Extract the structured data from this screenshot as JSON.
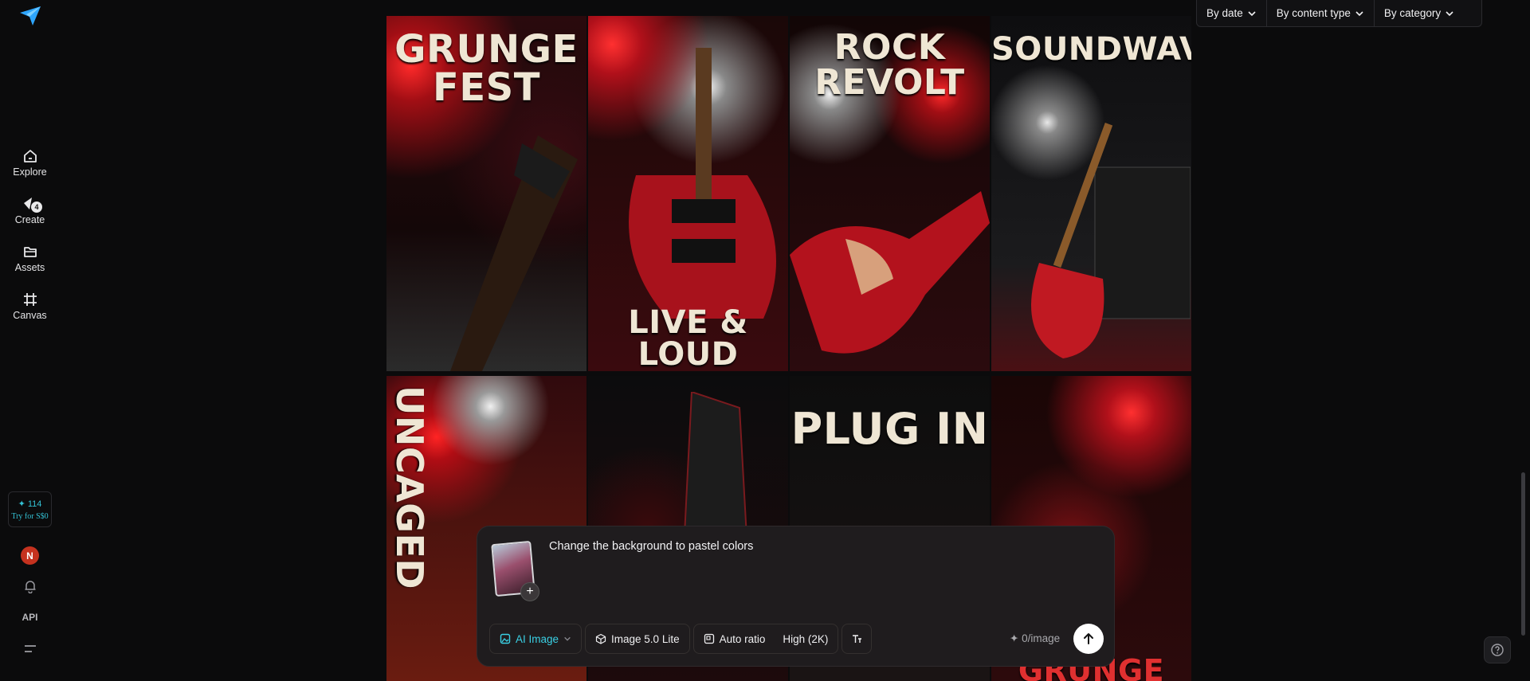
{
  "sidebar": {
    "nav": [
      {
        "label": "Explore"
      },
      {
        "label": "Create",
        "badge": "4"
      },
      {
        "label": "Assets"
      },
      {
        "label": "Canvas"
      }
    ],
    "credits": {
      "amount": "114",
      "offer": "Try for S$0"
    },
    "avatar_initial": "N",
    "api_label": "API"
  },
  "filters": [
    {
      "label": "By date"
    },
    {
      "label": "By content type"
    },
    {
      "label": "By category"
    }
  ],
  "gallery": {
    "tiles": [
      {
        "title": "GRUNGE\nFEST"
      },
      {
        "title": "LIVE & LOUD"
      },
      {
        "title": "ROCK REVOLT"
      },
      {
        "title": "SOUNDWAVE"
      },
      {
        "title": "UNCAGED"
      },
      {
        "title": ""
      },
      {
        "title": "PLUG IN"
      },
      {
        "title": "OF\nGRUNGE"
      }
    ]
  },
  "composer": {
    "prompt_value": "Change the background to pastel colors",
    "mode": "AI Image",
    "model": "Image 5.0 Lite",
    "ratio": "Auto ratio",
    "quality": "High (2K)",
    "cost": "0/image"
  },
  "colors": {
    "accent": "#3ad0e4",
    "avatar": "#c5321f"
  }
}
